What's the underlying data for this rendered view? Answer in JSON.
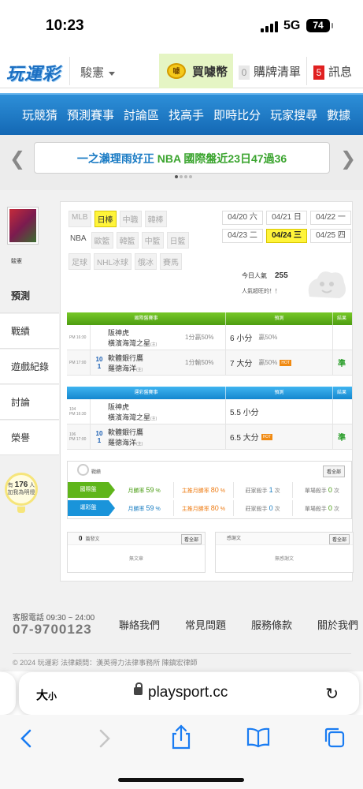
{
  "status": {
    "time": "10:23",
    "network": "5G",
    "battery": "74"
  },
  "topnav": {
    "logo": "玩運彩",
    "discount_label": "駿憲",
    "buy_label": "買噱幣",
    "coin_icon": "噱",
    "cart_count": "0",
    "cart_label": "購牌清單",
    "msg_count": "5",
    "msg_label": "訊息"
  },
  "bluemenu": [
    "玩競猜",
    "預測賽事",
    "討論區",
    "找高手",
    "即時比分",
    "玩家搜尋",
    "數據"
  ],
  "banner": {
    "text_a": "一之瀨理雨好正",
    "text_b": "NBA 國際盤近23日47過36"
  },
  "side": {
    "name": "駿憲",
    "tabs": [
      "預測",
      "戰績",
      "遊戲紀錄",
      "討論",
      "榮譽"
    ],
    "fans_prefix": "有",
    "fans_count": "176",
    "fans_unit": "人",
    "fans_text": "加我為明燈"
  },
  "leagues": {
    "row1": [
      "MLB",
      "日棒",
      "中職",
      "韓棒"
    ],
    "row2": [
      "NBA",
      "歐籃",
      "韓籃",
      "中籃",
      "日籃"
    ],
    "row3": [
      "足球",
      "NHL冰球",
      "俄冰",
      "賽馬"
    ]
  },
  "dates": [
    [
      "04/20 六",
      "04/21 日",
      "04/22 一"
    ],
    [
      "04/23 二",
      "04/24 三",
      "04/25 四"
    ]
  ],
  "popularity": {
    "label": "今日人氣",
    "value": "255",
    "tagline": "人氣超旺的！！"
  },
  "intl_table": {
    "headers": [
      "國際盤賽事",
      "預測",
      "結果"
    ],
    "rows": [
      {
        "time": "PM 16:30",
        "num1": "",
        "num2": "",
        "team1": "阪神虎",
        "team2": "橫濱海灣之星",
        "team2_tag": "(主)",
        "line": "1分贏50%",
        "pick": "6 小分",
        "rate": "贏50%",
        "ht": "",
        "result": ""
      },
      {
        "time": "PM 17:00",
        "num1": "10",
        "num2": "1",
        "team1": "軟體銀行鷹",
        "team2": "羅德海洋",
        "team2_tag": "(主)",
        "line": "1分輸50%",
        "pick": "7 大分",
        "rate": "贏50%",
        "ht": "HOT",
        "result": "準"
      }
    ]
  },
  "lottery_table": {
    "headers": [
      "運彩盤賽事",
      "預測",
      "結果"
    ],
    "rows": [
      {
        "time": "PM 16:30",
        "code": "104",
        "num1": "",
        "num2": "",
        "team1": "阪神虎",
        "team2": "橫濱海灣之星",
        "team2_tag": "(主)",
        "pick": "5.5 小分",
        "ht": "",
        "result": ""
      },
      {
        "time": "PM 17:00",
        "code": "106",
        "num1": "10",
        "num2": "1",
        "team1": "軟體銀行鷹",
        "team2": "羅德海洋",
        "team2_tag": "(主)",
        "pick": "6.5 大分",
        "ht": "HOT",
        "result": "準"
      }
    ]
  },
  "record": {
    "title": "戰績",
    "all_label": "看全部",
    "rows": [
      {
        "tag": "國際盤",
        "month_label": "月勝率",
        "month_val": "59",
        "main_label": "主推月勝率",
        "main_val": "80",
        "village_label": "莊家殺手",
        "village_val": "1",
        "single_label": "單場殺手",
        "single_val": "0",
        "unit": "次",
        "pct": "%"
      },
      {
        "tag": "運彩盤",
        "month_label": "月勝率",
        "month_val": "59",
        "main_label": "主推月勝率",
        "main_val": "80",
        "village_label": "莊家殺手",
        "village_val": "0",
        "single_label": "單場殺手",
        "single_val": "0",
        "unit": "次",
        "pct": "%"
      }
    ]
  },
  "posts": {
    "count": "0",
    "label": "篇發文",
    "all_label": "看全部",
    "empty": "無文章",
    "thanks_label": "感謝文",
    "thanks_empty": "無感謝文"
  },
  "footer": {
    "service": "客服電話 09:30 ~ 24:00",
    "phone": "07-9700123",
    "links": [
      "聯絡我們",
      "常見問題",
      "服務條款",
      "關於我們"
    ],
    "copyright": "© 2024 玩運彩 法律顧問：漢英得力法律事務所 陳鎮宏律師"
  },
  "browser": {
    "aa": "大",
    "aa_small": "小",
    "host": "playsport.cc"
  },
  "colors": {
    "brand_blue": "#1468b4",
    "green": "#5fb51a",
    "selected": "#fff43a"
  }
}
